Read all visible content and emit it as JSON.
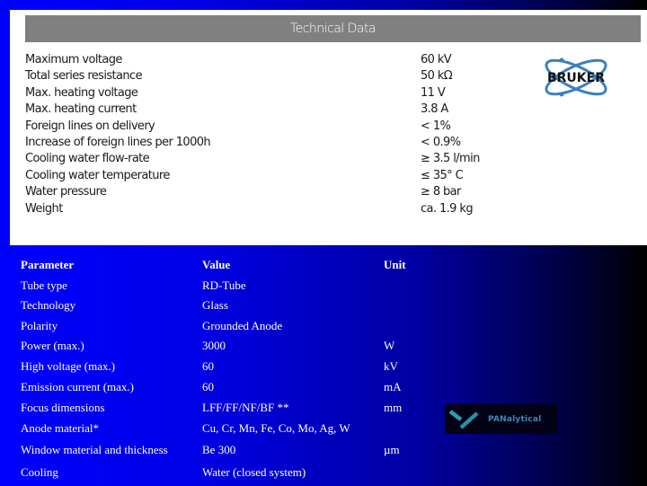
{
  "panel": {
    "title": "Technical Data",
    "specs": [
      {
        "label": "Maximum voltage",
        "value": "60 kV"
      },
      {
        "label": "Total series resistance",
        "value": "50 kΩ"
      },
      {
        "label": "Max. heating voltage",
        "value": "11 V"
      },
      {
        "label": "Max. heating current",
        "value": "3.8 A"
      },
      {
        "label": "Foreign lines on delivery",
        "value": "< 1%"
      },
      {
        "label": "Increase of foreign lines per 1000h",
        "value": "< 0.9%"
      },
      {
        "label": "Cooling water flow-rate",
        "value": "≥ 3.5 l/min"
      },
      {
        "label": "Cooling water temperature",
        "value": "≤ 35° C"
      },
      {
        "label": "Water pressure",
        "value": "≥ 8 bar"
      },
      {
        "label": "Weight",
        "value": "ca. 1.9 kg"
      }
    ],
    "logo": {
      "text": "BRUKER",
      "icon": "atom-orbit-icon",
      "color": "#3a7fc0"
    }
  },
  "table": {
    "headers": {
      "parameter": "Parameter",
      "value": "Value",
      "unit": "Unit"
    },
    "rows": [
      {
        "parameter": "Tube type",
        "value": "RD-Tube",
        "unit": ""
      },
      {
        "parameter": "Technology",
        "value": "Glass",
        "unit": ""
      },
      {
        "parameter": "Polarity",
        "value": "Grounded Anode",
        "unit": ""
      },
      {
        "parameter": "Power (max.)",
        "value": "3000",
        "unit": "W"
      },
      {
        "parameter": "High voltage (max.)",
        "value": "60",
        "unit": "kV"
      },
      {
        "parameter": "Emission current (max.)",
        "value": "60",
        "unit": "mA"
      },
      {
        "parameter": "Focus dimensions",
        "value": "LFF/FF/NF/BF **",
        "unit": "mm"
      },
      {
        "parameter": "Anode material*",
        "value": "Cu, Cr, Mn, Fe, Co, Mo, Ag, W",
        "unit": ""
      },
      {
        "parameter": "Window material and thickness",
        "value": "Be 300",
        "unit": "µm"
      },
      {
        "parameter": "Cooling",
        "value": "Water (closed system)",
        "unit": ""
      }
    ]
  },
  "partner_logo": {
    "text": "PANalytical",
    "icon": "panalytical-check-icon"
  }
}
